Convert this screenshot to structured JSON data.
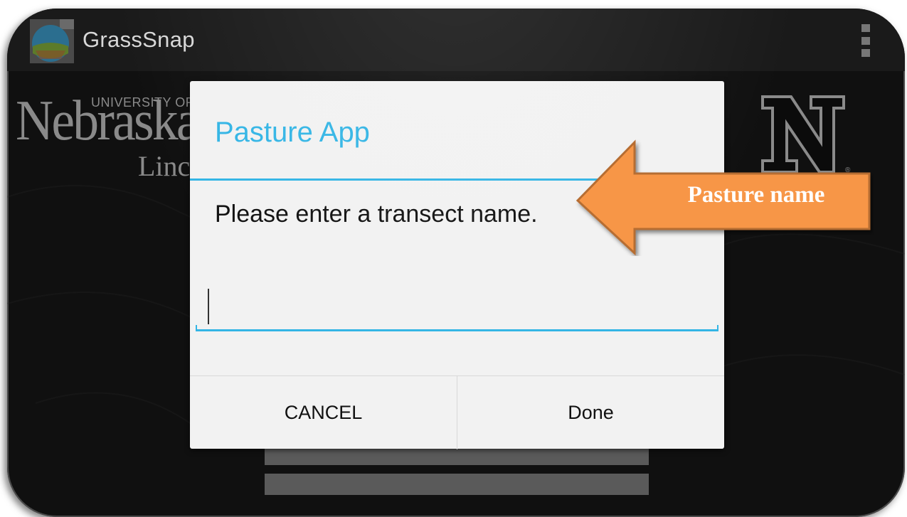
{
  "app": {
    "title": "GrassSnap"
  },
  "background": {
    "university_small": "UNIVERSITY OF",
    "university_name": "Nebraska",
    "campus": "Lincoln"
  },
  "dialog": {
    "title": "Pasture App",
    "message": "Please enter a transect name.",
    "input_value": "",
    "cancel_label": "CANCEL",
    "done_label": "Done"
  },
  "annotation": {
    "label": "Pasture name"
  },
  "colors": {
    "accent": "#33b5e5",
    "arrow_fill": "#f79646",
    "arrow_border": "#b66d31"
  }
}
